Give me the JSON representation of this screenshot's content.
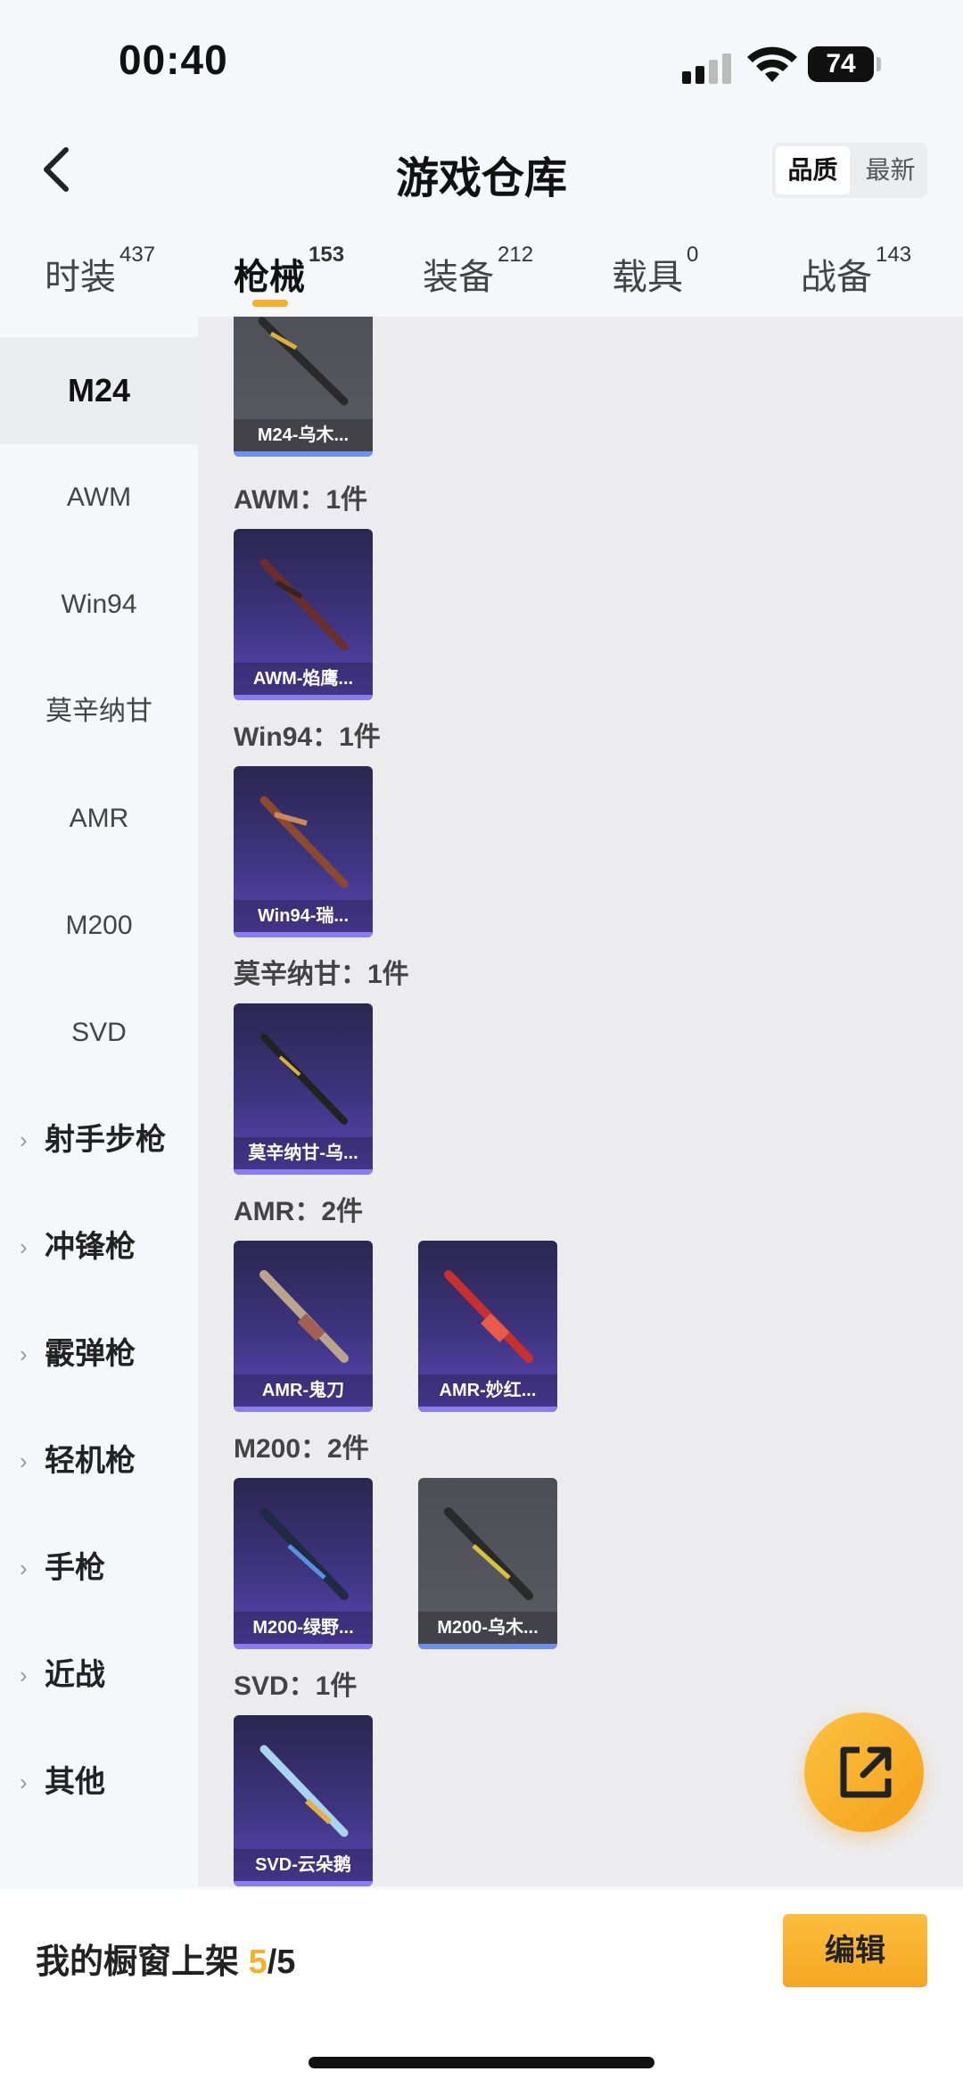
{
  "status": {
    "time": "00:40",
    "battery": "74"
  },
  "header": {
    "title": "游戏仓库",
    "sort_options": [
      "品质",
      "最新"
    ],
    "sort_selected": "品质"
  },
  "tabs": [
    {
      "label": "时装",
      "count": "437"
    },
    {
      "label": "枪械",
      "count": "153"
    },
    {
      "label": "装备",
      "count": "212"
    },
    {
      "label": "载具",
      "count": "0"
    },
    {
      "label": "战备",
      "count": "143"
    }
  ],
  "sidebar": {
    "items": [
      "M24",
      "AWM",
      "Win94",
      "莫辛纳甘",
      "AMR",
      "M200",
      "SVD"
    ],
    "groups": [
      "射手步枪",
      "冲锋枪",
      "霰弹枪",
      "轻机枪",
      "手枪",
      "近战",
      "其他"
    ]
  },
  "sections": [
    {
      "label": "AWM：1件"
    },
    {
      "label": "Win94：1件"
    },
    {
      "label": "莫辛纳甘：1件"
    },
    {
      "label": "AMR：2件"
    },
    {
      "label": "M200：2件"
    },
    {
      "label": "SVD：1件"
    }
  ],
  "cards": [
    {
      "name": "M24-乌木...",
      "rarity": "gray"
    },
    {
      "name": "AWM-焰鹰...",
      "rarity": "purple"
    },
    {
      "name": "Win94-瑞...",
      "rarity": "purple"
    },
    {
      "name": "莫辛纳甘-乌...",
      "rarity": "purple"
    },
    {
      "name": "AMR-鬼刀",
      "rarity": "purple"
    },
    {
      "name": "AMR-妙红...",
      "rarity": "purple"
    },
    {
      "name": "M200-绿野...",
      "rarity": "purple"
    },
    {
      "name": "M200-乌木...",
      "rarity": "gray"
    },
    {
      "name": "SVD-云朵鹅",
      "rarity": "purple"
    }
  ],
  "bottom": {
    "shelf_label": "我的橱窗上架",
    "shelf_current": "5",
    "shelf_total": "/5",
    "edit_label": "编辑"
  },
  "colors": {
    "accent": "#f5b02a",
    "purple_card": "#3f3480",
    "gray_card": "#55565d"
  },
  "icons": {
    "back": "chevron-left-icon",
    "fab": "share-export-icon",
    "group_chevron": "chevron-right-icon"
  }
}
